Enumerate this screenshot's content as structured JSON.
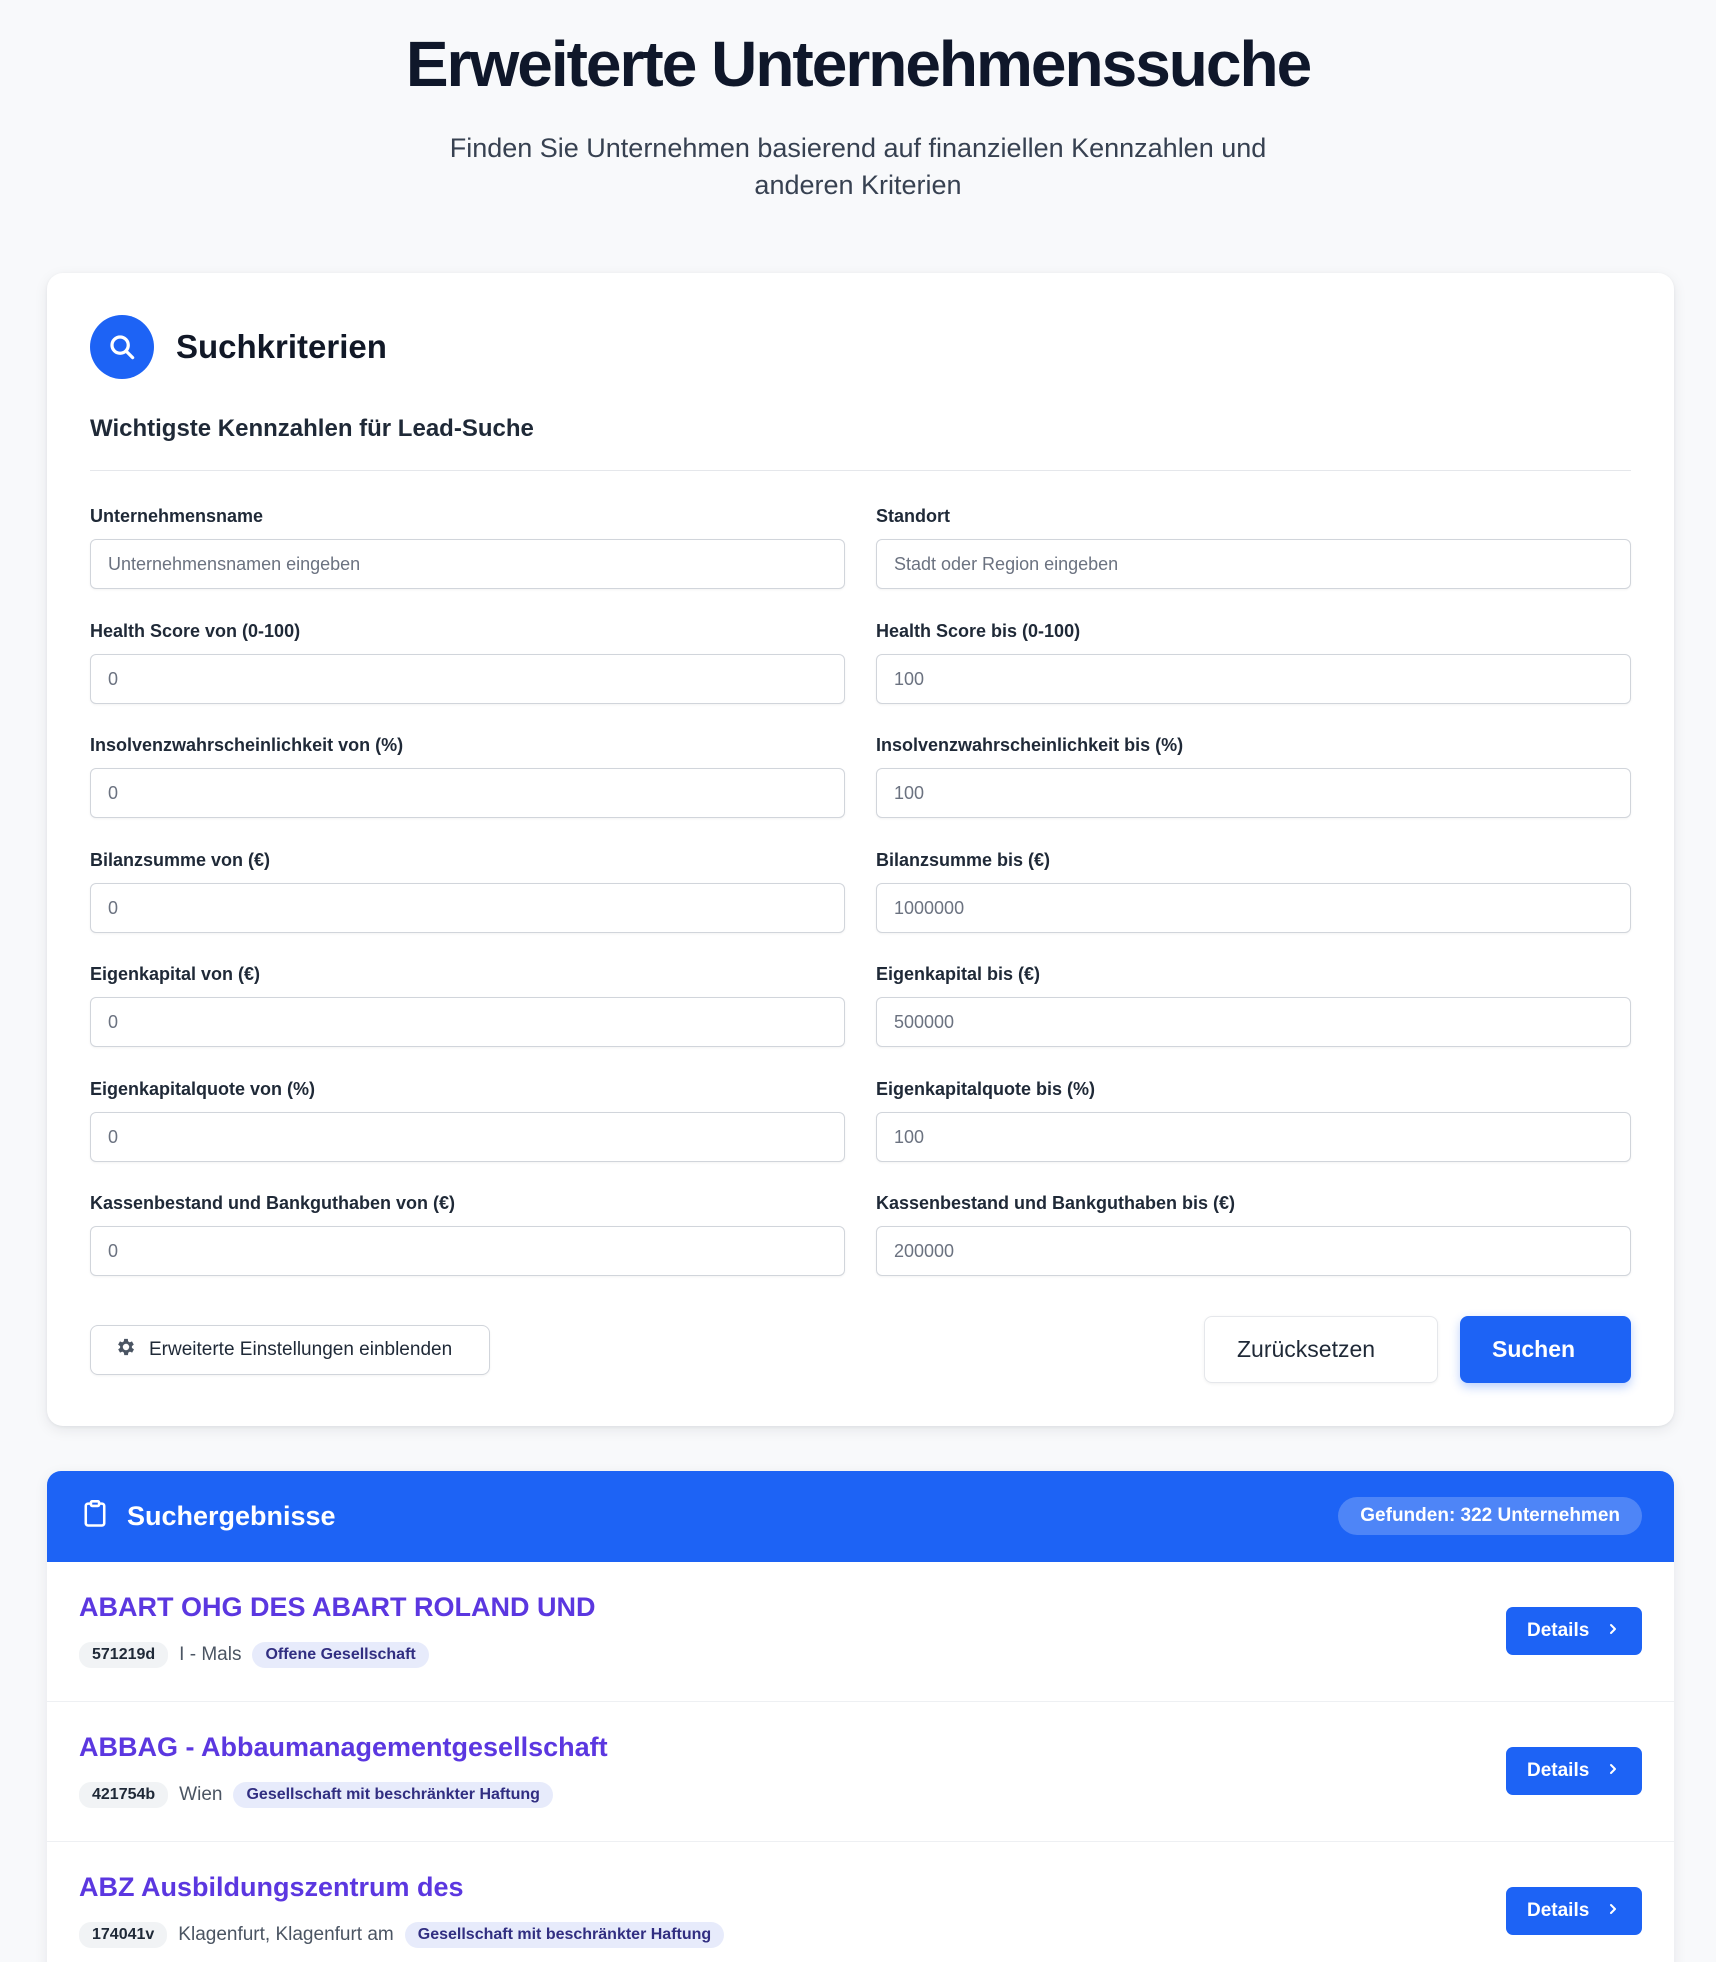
{
  "header": {
    "title": "Erweiterte Unternehmenssuche",
    "subtitle": "Finden Sie Unternehmen basierend auf finanziellen Kennzahlen und anderen Kriterien"
  },
  "criteria": {
    "title": "Suchkriterien",
    "icon": "search-icon",
    "section_title": "Wichtigste Kennzahlen für Lead-Suche",
    "fields": {
      "company_name": {
        "label": "Unternehmensname",
        "placeholder": "Unternehmensnamen eingeben"
      },
      "location": {
        "label": "Standort",
        "placeholder": "Stadt oder Region eingeben"
      },
      "health_from": {
        "label": "Health Score von (0-100)",
        "placeholder": "0"
      },
      "health_to": {
        "label": "Health Score bis (0-100)",
        "placeholder": "100"
      },
      "insolvency_from": {
        "label": "Insolvenzwahrscheinlichkeit von (%)",
        "placeholder": "0"
      },
      "insolvency_to": {
        "label": "Insolvenzwahrscheinlichkeit bis (%)",
        "placeholder": "100"
      },
      "balance_from": {
        "label": "Bilanzsumme von (€)",
        "placeholder": "0"
      },
      "balance_to": {
        "label": "Bilanzsumme bis (€)",
        "placeholder": "1000000"
      },
      "equity_from": {
        "label": "Eigenkapital von (€)",
        "placeholder": "0"
      },
      "equity_to": {
        "label": "Eigenkapital bis (€)",
        "placeholder": "500000"
      },
      "equity_ratio_from": {
        "label": "Eigenkapitalquote von (%)",
        "placeholder": "0"
      },
      "equity_ratio_to": {
        "label": "Eigenkapitalquote bis (%)",
        "placeholder": "100"
      },
      "cash_from": {
        "label": "Kassenbestand und Bankguthaben von (€)",
        "placeholder": "0"
      },
      "cash_to": {
        "label": "Kassenbestand und Bankguthaben bis (€)",
        "placeholder": "200000"
      }
    },
    "advanced_label": "Erweiterte Einstellungen einblenden",
    "reset_label": "Zurücksetzen",
    "search_label": "Suchen"
  },
  "results": {
    "title": "Suchergebnisse",
    "icon": "clipboard-icon",
    "found_label": "Gefunden: 322 Unternehmen",
    "details_label": "Details",
    "items": [
      {
        "name": "ABART OHG DES ABART ROLAND UND",
        "id": "571219d",
        "location": "I - Mals",
        "type": "Offene Gesellschaft"
      },
      {
        "name": "ABBAG - Abbaumanagementgesellschaft",
        "id": "421754b",
        "location": "Wien",
        "type": "Gesellschaft mit beschränkter Haftung"
      },
      {
        "name": "ABZ Ausbildungszentrum des",
        "id": "174041v",
        "location": "Klagenfurt, Klagenfurt am",
        "type": "Gesellschaft mit beschränkter Haftung"
      }
    ]
  },
  "colors": {
    "primary": "#1d63f5",
    "company_name": "#5b37e0"
  }
}
